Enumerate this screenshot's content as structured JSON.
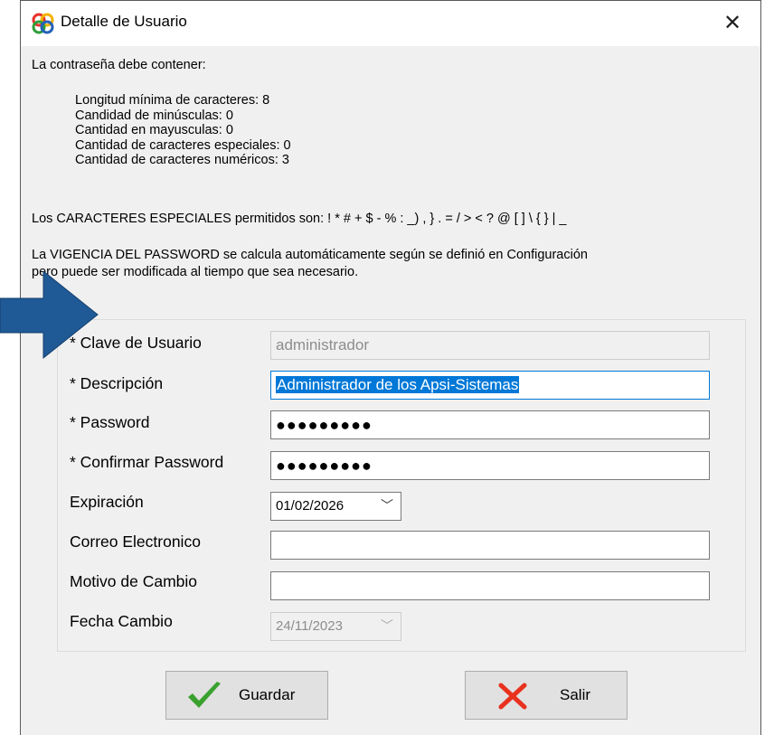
{
  "window": {
    "title": "Detalle de Usuario"
  },
  "info": {
    "intro": "La contraseña debe contener:",
    "rules": [
      "Longitud mínima de caracteres: 8",
      "Candidad de minúsculas: 0",
      "Cantidad en mayusculas: 0",
      "Cantidad de caracteres especiales: 0",
      "Cantidad de caracteres numéricos: 3"
    ],
    "special_chars": "Los CARACTERES ESPECIALES permitidos son: ! * # + $ - % : _) , } . = / > < ? @ [ ] \\ { } | _",
    "vigencia_line1": "La VIGENCIA DEL PASSWORD se calcula automáticamente según se definió en Configuración",
    "vigencia_line2": "pero puede ser modificada al tiempo que sea necesario."
  },
  "form": {
    "clave_label": "* Clave de Usuario",
    "clave_value": "administrador",
    "descripcion_label": "* Descripción",
    "descripcion_value": "Administrador de los Apsi-Sistemas",
    "password_label": "* Password",
    "password_value": "●●●●●●●●●",
    "confirmar_label": "* Confirmar Password",
    "confirmar_value": "●●●●●●●●●",
    "expiracion_label": "Expiración",
    "expiracion_value": "01/02/2026",
    "correo_label": "Correo Electronico",
    "correo_value": "",
    "motivo_label": "Motivo de Cambio",
    "motivo_value": "",
    "fecha_label": "Fecha Cambio",
    "fecha_value": "24/11/2023"
  },
  "buttons": {
    "guardar": "Guardar",
    "salir": "Salir"
  },
  "colors": {
    "accent": "#0078d7",
    "arrow": "#1f5a96",
    "check": "#3aa12f",
    "x": "#e8321e"
  }
}
